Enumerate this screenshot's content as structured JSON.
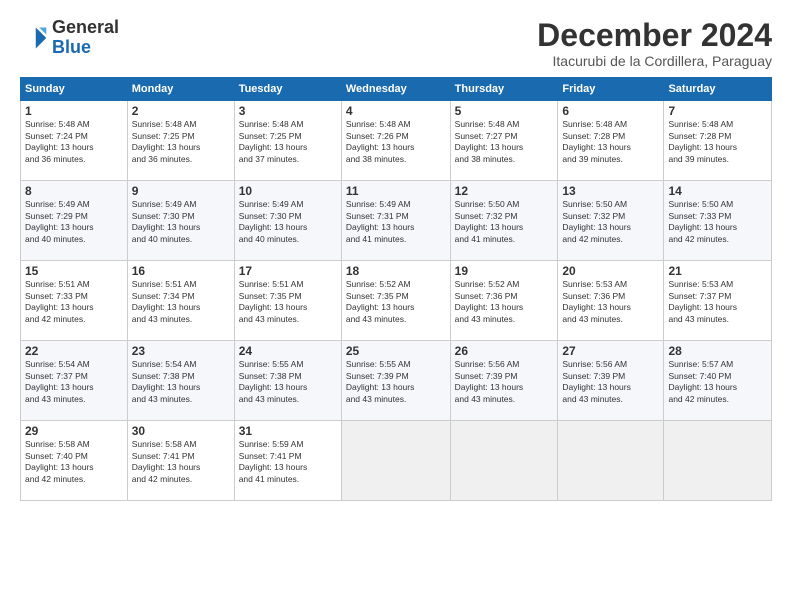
{
  "logo": {
    "general": "General",
    "blue": "Blue"
  },
  "title": "December 2024",
  "location": "Itacurubi de la Cordillera, Paraguay",
  "weekdays": [
    "Sunday",
    "Monday",
    "Tuesday",
    "Wednesday",
    "Thursday",
    "Friday",
    "Saturday"
  ],
  "weeks": [
    [
      {
        "day": 1,
        "sunrise": "5:48 AM",
        "sunset": "7:24 PM",
        "daylight": "13 hours and 36 minutes."
      },
      {
        "day": 2,
        "sunrise": "5:48 AM",
        "sunset": "7:25 PM",
        "daylight": "13 hours and 36 minutes."
      },
      {
        "day": 3,
        "sunrise": "5:48 AM",
        "sunset": "7:25 PM",
        "daylight": "13 hours and 37 minutes."
      },
      {
        "day": 4,
        "sunrise": "5:48 AM",
        "sunset": "7:26 PM",
        "daylight": "13 hours and 38 minutes."
      },
      {
        "day": 5,
        "sunrise": "5:48 AM",
        "sunset": "7:27 PM",
        "daylight": "13 hours and 38 minutes."
      },
      {
        "day": 6,
        "sunrise": "5:48 AM",
        "sunset": "7:28 PM",
        "daylight": "13 hours and 39 minutes."
      },
      {
        "day": 7,
        "sunrise": "5:48 AM",
        "sunset": "7:28 PM",
        "daylight": "13 hours and 39 minutes."
      }
    ],
    [
      {
        "day": 8,
        "sunrise": "5:49 AM",
        "sunset": "7:29 PM",
        "daylight": "13 hours and 40 minutes."
      },
      {
        "day": 9,
        "sunrise": "5:49 AM",
        "sunset": "7:30 PM",
        "daylight": "13 hours and 40 minutes."
      },
      {
        "day": 10,
        "sunrise": "5:49 AM",
        "sunset": "7:30 PM",
        "daylight": "13 hours and 40 minutes."
      },
      {
        "day": 11,
        "sunrise": "5:49 AM",
        "sunset": "7:31 PM",
        "daylight": "13 hours and 41 minutes."
      },
      {
        "day": 12,
        "sunrise": "5:50 AM",
        "sunset": "7:32 PM",
        "daylight": "13 hours and 41 minutes."
      },
      {
        "day": 13,
        "sunrise": "5:50 AM",
        "sunset": "7:32 PM",
        "daylight": "13 hours and 42 minutes."
      },
      {
        "day": 14,
        "sunrise": "5:50 AM",
        "sunset": "7:33 PM",
        "daylight": "13 hours and 42 minutes."
      }
    ],
    [
      {
        "day": 15,
        "sunrise": "5:51 AM",
        "sunset": "7:33 PM",
        "daylight": "13 hours and 42 minutes."
      },
      {
        "day": 16,
        "sunrise": "5:51 AM",
        "sunset": "7:34 PM",
        "daylight": "13 hours and 43 minutes."
      },
      {
        "day": 17,
        "sunrise": "5:51 AM",
        "sunset": "7:35 PM",
        "daylight": "13 hours and 43 minutes."
      },
      {
        "day": 18,
        "sunrise": "5:52 AM",
        "sunset": "7:35 PM",
        "daylight": "13 hours and 43 minutes."
      },
      {
        "day": 19,
        "sunrise": "5:52 AM",
        "sunset": "7:36 PM",
        "daylight": "13 hours and 43 minutes."
      },
      {
        "day": 20,
        "sunrise": "5:53 AM",
        "sunset": "7:36 PM",
        "daylight": "13 hours and 43 minutes."
      },
      {
        "day": 21,
        "sunrise": "5:53 AM",
        "sunset": "7:37 PM",
        "daylight": "13 hours and 43 minutes."
      }
    ],
    [
      {
        "day": 22,
        "sunrise": "5:54 AM",
        "sunset": "7:37 PM",
        "daylight": "13 hours and 43 minutes."
      },
      {
        "day": 23,
        "sunrise": "5:54 AM",
        "sunset": "7:38 PM",
        "daylight": "13 hours and 43 minutes."
      },
      {
        "day": 24,
        "sunrise": "5:55 AM",
        "sunset": "7:38 PM",
        "daylight": "13 hours and 43 minutes."
      },
      {
        "day": 25,
        "sunrise": "5:55 AM",
        "sunset": "7:39 PM",
        "daylight": "13 hours and 43 minutes."
      },
      {
        "day": 26,
        "sunrise": "5:56 AM",
        "sunset": "7:39 PM",
        "daylight": "13 hours and 43 minutes."
      },
      {
        "day": 27,
        "sunrise": "5:56 AM",
        "sunset": "7:39 PM",
        "daylight": "13 hours and 43 minutes."
      },
      {
        "day": 28,
        "sunrise": "5:57 AM",
        "sunset": "7:40 PM",
        "daylight": "13 hours and 42 minutes."
      }
    ],
    [
      {
        "day": 29,
        "sunrise": "5:58 AM",
        "sunset": "7:40 PM",
        "daylight": "13 hours and 42 minutes."
      },
      {
        "day": 30,
        "sunrise": "5:58 AM",
        "sunset": "7:41 PM",
        "daylight": "13 hours and 42 minutes."
      },
      {
        "day": 31,
        "sunrise": "5:59 AM",
        "sunset": "7:41 PM",
        "daylight": "13 hours and 41 minutes."
      },
      null,
      null,
      null,
      null
    ]
  ]
}
